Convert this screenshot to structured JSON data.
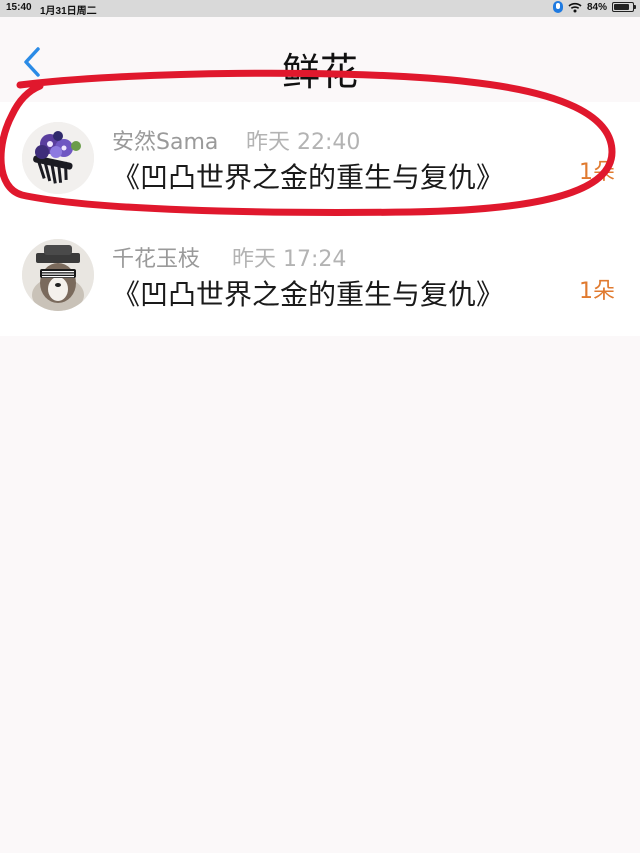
{
  "status_bar": {
    "time": "15:40",
    "date": "1月31日周二",
    "battery": "84%"
  },
  "nav": {
    "title": "鲜花",
    "back_icon": "chevron-left-icon"
  },
  "list": [
    {
      "user": "安然Sama",
      "time": "昨天 22:40",
      "book": "《凹凸世界之金的重生与复仇》",
      "count": "1朵"
    },
    {
      "user": "千花玉枝",
      "time": "昨天 17:24",
      "book": "《凹凸世界之金的重生与复仇》",
      "count": "1朵"
    }
  ],
  "colors": {
    "accent_blue": "#2b8be6",
    "count_orange": "#e07a2f",
    "annotation_red": "#e0182d"
  }
}
